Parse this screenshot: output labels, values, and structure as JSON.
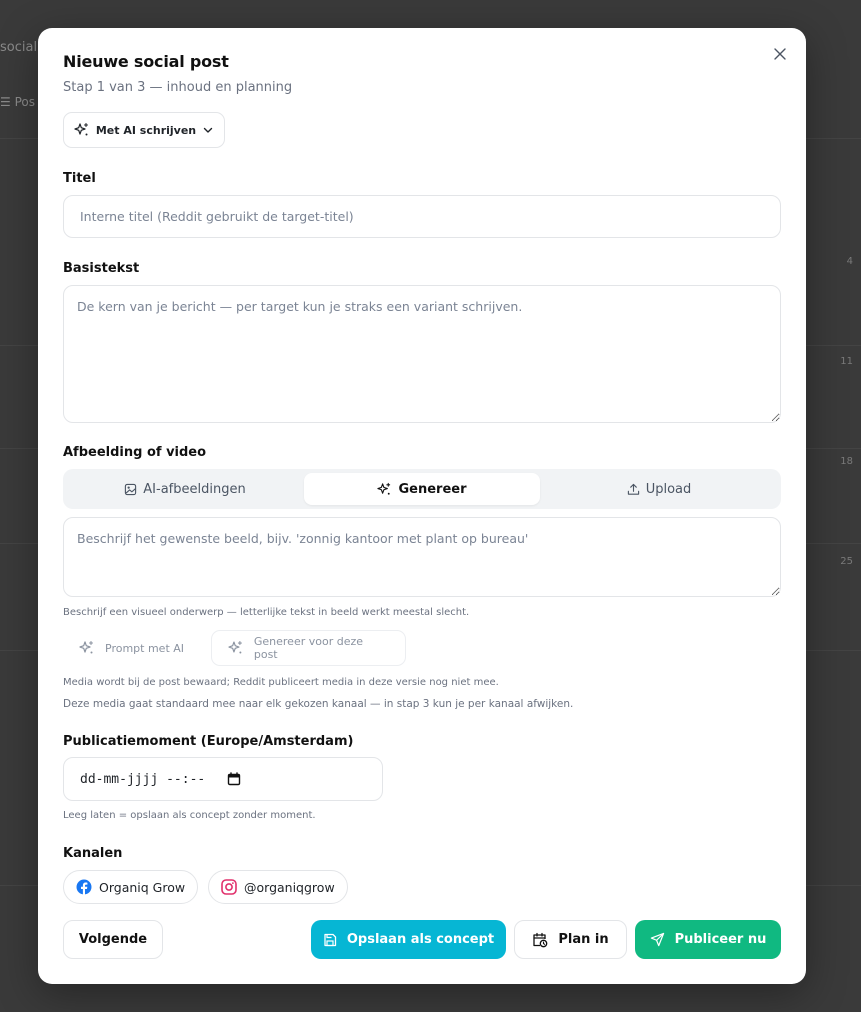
{
  "background": {
    "heading": "social",
    "tab": "☰ Pos",
    "day_numbers": [
      "4",
      "11",
      "18",
      "25"
    ]
  },
  "modal": {
    "title": "Nieuwe social post",
    "subtitle": "Stap 1 van 3 — inhoud en planning",
    "close_icon": "close-icon"
  },
  "ai_writer": {
    "label": "Met AI schrijven",
    "icon": "sparkles-icon"
  },
  "title_field": {
    "label": "Titel",
    "value": "",
    "placeholder": "Interne titel (Reddit gebruikt de target-titel)"
  },
  "body_field": {
    "label": "Basistekst",
    "value": "",
    "placeholder": "De kern van je bericht — per target kun je straks een variant schrijven."
  },
  "media": {
    "label": "Afbeelding of video",
    "tabs": [
      {
        "label": "AI-afbeeldingen",
        "icon": "image-icon",
        "active": false
      },
      {
        "label": "Genereer",
        "icon": "sparkles-icon",
        "active": true
      },
      {
        "label": "Upload",
        "icon": "upload-icon",
        "active": false
      }
    ],
    "prompt_placeholder": "Beschrijf het gewenste beeld, bijv. 'zonnig kantoor met plant op bureau'",
    "prompt_value": "",
    "prompt_hint": "Beschrijf een visueel onderwerp — letterlijke tekst in beeld werkt meestal slecht.",
    "prompt_ai_label": "Prompt met AI",
    "generate_label": "Genereer voor deze post",
    "note_1": "Media wordt bij de post bewaard; Reddit publiceert media in deze versie nog niet mee.",
    "note_2": "Deze media gaat standaard mee naar elk gekozen kanaal — in stap 3 kun je per kanaal afwijken."
  },
  "schedule": {
    "label": "Publicatiemoment (Europe/Amsterdam)",
    "display": "dd-mm-jjjj --:--",
    "hint": "Leeg laten = opslaan als concept zonder moment."
  },
  "channels": {
    "label": "Kanalen",
    "items": [
      {
        "label": "Organiq Grow",
        "icon": "facebook-icon",
        "color": "#1877F2"
      },
      {
        "label": "@organiqgrow",
        "icon": "instagram-icon",
        "color": "#E1306C"
      }
    ]
  },
  "footer": {
    "next_label": "Volgende",
    "save_draft_label": "Opslaan als concept",
    "schedule_label": "Plan in",
    "publish_label": "Publiceer nu"
  },
  "colors": {
    "draft": "#06B6D4",
    "publish": "#10B981"
  }
}
